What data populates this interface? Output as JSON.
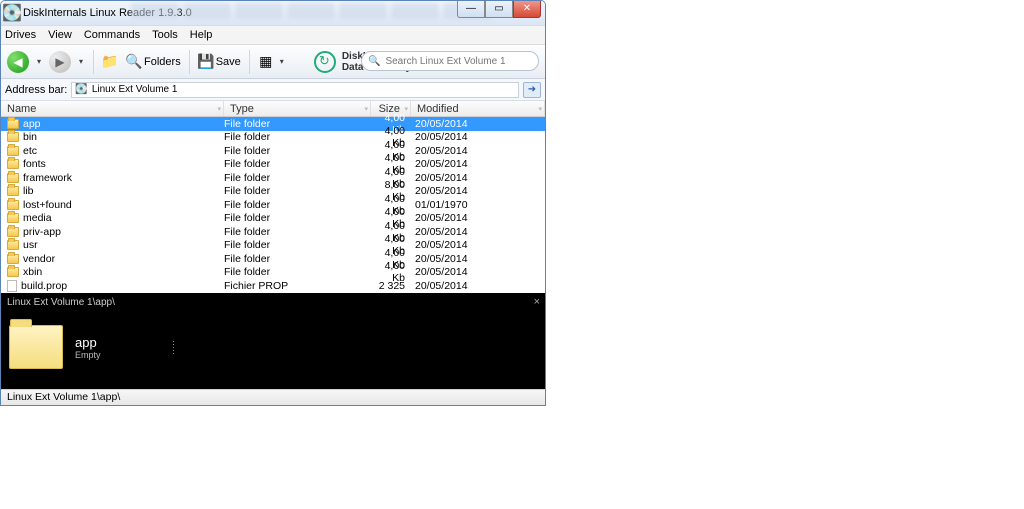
{
  "title": "DiskInternals Linux Reader 1.9.3.0",
  "menu": {
    "drives": "Drives",
    "view": "View",
    "commands": "Commands",
    "tools": "Tools",
    "help": "Help"
  },
  "toolbar": {
    "folders": "Folders",
    "save": "Save"
  },
  "branding": {
    "line1": "DiskInternals",
    "line2": "Data Recovery Software"
  },
  "search": {
    "placeholder": "Search Linux Ext Volume 1"
  },
  "addr": {
    "label": "Address bar:",
    "value": "Linux Ext Volume 1"
  },
  "columns": {
    "name": "Name",
    "type": "Type",
    "size": "Size",
    "modified": "Modified"
  },
  "rows": [
    {
      "name": "app",
      "type": "File folder",
      "size": "4,00 Kb",
      "mod": "20/05/2014",
      "icon": "folder",
      "sel": true
    },
    {
      "name": "bin",
      "type": "File folder",
      "size": "4,00 Kb",
      "mod": "20/05/2014",
      "icon": "folder"
    },
    {
      "name": "etc",
      "type": "File folder",
      "size": "4,00 Kb",
      "mod": "20/05/2014",
      "icon": "folder"
    },
    {
      "name": "fonts",
      "type": "File folder",
      "size": "4,00 Kb",
      "mod": "20/05/2014",
      "icon": "folder"
    },
    {
      "name": "framework",
      "type": "File folder",
      "size": "4,00 Kb",
      "mod": "20/05/2014",
      "icon": "folder"
    },
    {
      "name": "lib",
      "type": "File folder",
      "size": "8,00 Kb",
      "mod": "20/05/2014",
      "icon": "folder"
    },
    {
      "name": "lost+found",
      "type": "File folder",
      "size": "4,00 Kb",
      "mod": "01/01/1970",
      "icon": "folder"
    },
    {
      "name": "media",
      "type": "File folder",
      "size": "4,00 Kb",
      "mod": "20/05/2014",
      "icon": "folder"
    },
    {
      "name": "priv-app",
      "type": "File folder",
      "size": "4,00 Kb",
      "mod": "20/05/2014",
      "icon": "folder"
    },
    {
      "name": "usr",
      "type": "File folder",
      "size": "4,00 Kb",
      "mod": "20/05/2014",
      "icon": "folder"
    },
    {
      "name": "vendor",
      "type": "File folder",
      "size": "4,00 Kb",
      "mod": "20/05/2014",
      "icon": "folder"
    },
    {
      "name": "xbin",
      "type": "File folder",
      "size": "4,00 Kb",
      "mod": "20/05/2014",
      "icon": "folder"
    },
    {
      "name": "build.prop",
      "type": "Fichier PROP",
      "size": "2 325",
      "mod": "20/05/2014",
      "icon": "file"
    }
  ],
  "preview": {
    "title": "Linux Ext Volume 1\\app\\",
    "name": "app",
    "sub": "Empty"
  },
  "status": "Linux Ext Volume 1\\app\\"
}
